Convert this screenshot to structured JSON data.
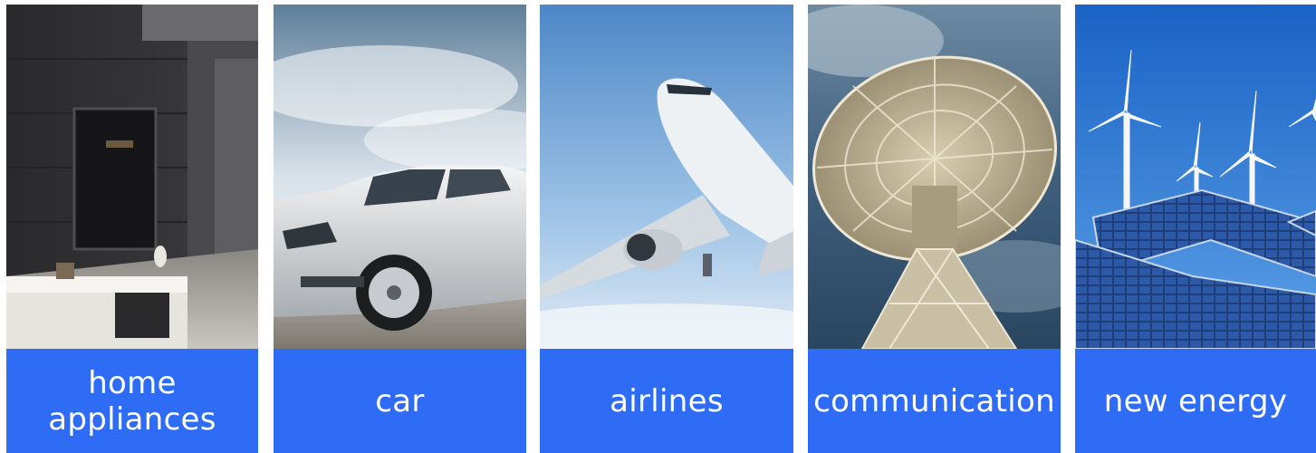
{
  "accent_color": "#2f6cf6",
  "categories": [
    {
      "label": "home\nappliances",
      "image_icon": "living-room-tv-photo"
    },
    {
      "label": "car",
      "image_icon": "silver-car-photo"
    },
    {
      "label": "airlines",
      "image_icon": "airplane-photo"
    },
    {
      "label": "communication",
      "image_icon": "satellite-dish-photo"
    },
    {
      "label": "new energy",
      "image_icon": "wind-solar-photo"
    }
  ]
}
